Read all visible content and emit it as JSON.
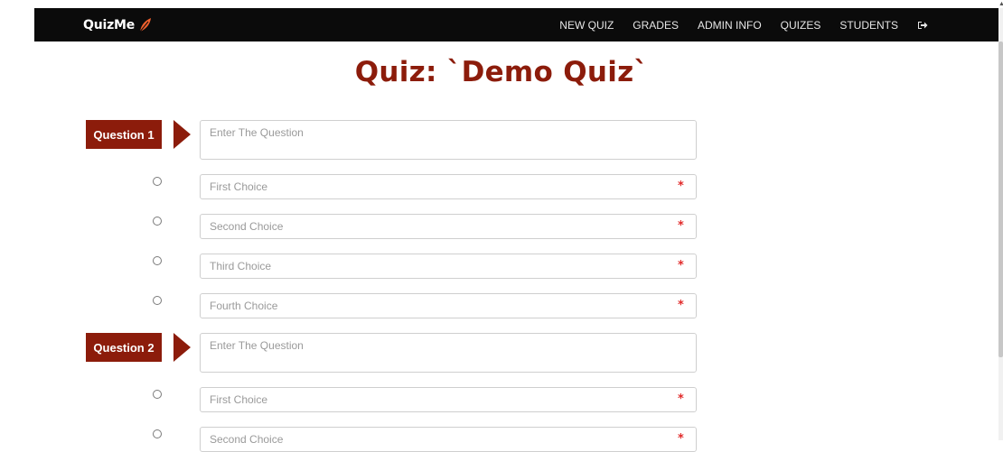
{
  "app": {
    "brand": "QuizMe"
  },
  "nav": {
    "items": [
      "NEW QUIZ",
      "GRADES",
      "ADMIN INFO",
      "QUIZES",
      "STUDENTS"
    ],
    "logout_icon": "sign-out-icon"
  },
  "page": {
    "title": "Quiz: `Demo Quiz`"
  },
  "questions": [
    {
      "label": "Question 1",
      "question_placeholder": "Enter The Question",
      "choices": [
        {
          "placeholder": "First Choice",
          "required_mark": "*"
        },
        {
          "placeholder": "Second Choice",
          "required_mark": "*"
        },
        {
          "placeholder": "Third Choice",
          "required_mark": "*"
        },
        {
          "placeholder": "Fourth Choice",
          "required_mark": "*"
        }
      ]
    },
    {
      "label": "Question 2",
      "question_placeholder": "Enter The Question",
      "choices": [
        {
          "placeholder": "First Choice",
          "required_mark": "*"
        },
        {
          "placeholder": "Second Choice",
          "required_mark": "*"
        }
      ]
    }
  ],
  "colors": {
    "accent": "#8c1c0b",
    "navbar": "#0b0b0b",
    "required": "#e12a2a",
    "brand_leaf": "#f2612e"
  },
  "icons": {
    "brand": "leaf-icon",
    "arrow": "arrow-right-icon",
    "radio": "radio-icon"
  }
}
